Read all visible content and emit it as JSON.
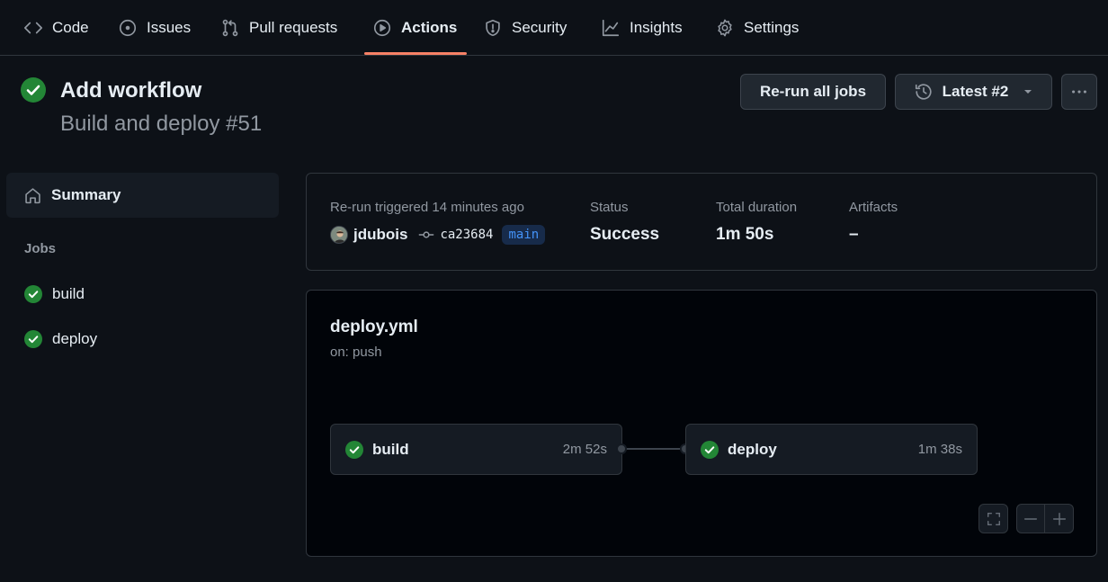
{
  "nav": {
    "tabs": [
      {
        "label": "Code",
        "icon": "code-icon"
      },
      {
        "label": "Issues",
        "icon": "issue-opened-icon"
      },
      {
        "label": "Pull requests",
        "icon": "git-pull-request-icon"
      },
      {
        "label": "Actions",
        "icon": "play-icon",
        "active": true
      },
      {
        "label": "Security",
        "icon": "shield-icon"
      },
      {
        "label": "Insights",
        "icon": "graph-icon"
      },
      {
        "label": "Settings",
        "icon": "gear-icon"
      }
    ],
    "active_color": "#f78166"
  },
  "run": {
    "title": "Add workflow",
    "subtitle": "Build and deploy #51",
    "status_icon": "check-circle-fill-icon",
    "rerun_label": "Re-run all jobs",
    "attempt_label": "Latest #2",
    "more_icon": "kebab-horizontal-icon"
  },
  "sidebar": {
    "summary_label": "Summary",
    "jobs_heading": "Jobs",
    "jobs": [
      {
        "name": "build",
        "status": "success"
      },
      {
        "name": "deploy",
        "status": "success"
      }
    ]
  },
  "summary": {
    "trigger_label": "Re-run triggered 14 minutes ago",
    "actor": "jdubois",
    "commit": "ca23684",
    "branch": "main",
    "status_label": "Status",
    "status_value": "Success",
    "duration_label": "Total duration",
    "duration_value": "1m 50s",
    "artifacts_label": "Artifacts",
    "artifacts_value": "–"
  },
  "graph": {
    "workflow_file": "deploy.yml",
    "trigger": "on: push",
    "jobs": [
      {
        "name": "build",
        "duration": "2m 52s",
        "status": "success"
      },
      {
        "name": "deploy",
        "duration": "1m 38s",
        "status": "success"
      }
    ],
    "controls": [
      "fullscreen-icon",
      "zoom-out-icon",
      "zoom-in-icon"
    ]
  },
  "colors": {
    "success": "#238636",
    "background": "#0d1117",
    "branch_text": "#4493f8"
  }
}
